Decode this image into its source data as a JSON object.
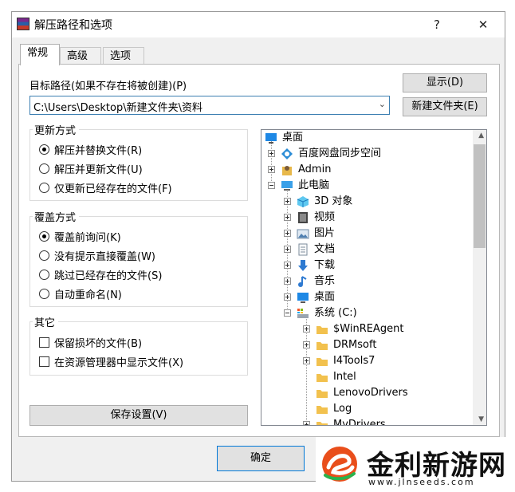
{
  "window": {
    "title": "解压路径和选项",
    "help_glyph": "?",
    "close_glyph": "✕"
  },
  "tabs": [
    "常规",
    "高级",
    "选项"
  ],
  "target": {
    "label": "目标路径(如果不存在将被创建)(P)",
    "value": "C:\\Users\\Desktop\\新建文件夹\\资料",
    "arrow": "⌄"
  },
  "buttons": {
    "show": "显示(D)",
    "new_folder": "新建文件夹(E)",
    "save": "保存设置(V)",
    "ok": "确定"
  },
  "update_mode": {
    "title": "更新方式",
    "options": [
      "解压并替换文件(R)",
      "解压并更新文件(U)",
      "仅更新已经存在的文件(F)"
    ],
    "selected": 0
  },
  "overwrite_mode": {
    "title": "覆盖方式",
    "options": [
      "覆盖前询问(K)",
      "没有提示直接覆盖(W)",
      "跳过已经存在的文件(S)",
      "自动重命名(N)"
    ],
    "selected": 0
  },
  "misc": {
    "title": "其它",
    "options": [
      "保留损坏的文件(B)",
      "在资源管理器中显示文件(X)"
    ]
  },
  "tree": [
    {
      "label": "桌面",
      "icon": "desktop-icon"
    },
    {
      "label": "百度网盘同步空间",
      "icon": "baidu-cloud-icon"
    },
    {
      "label": "Admin",
      "icon": "user-icon"
    },
    {
      "label": "此电脑",
      "icon": "computer-icon"
    },
    {
      "label": "3D 对象",
      "icon": "3d-objects-icon"
    },
    {
      "label": "视频",
      "icon": "video-icon"
    },
    {
      "label": "图片",
      "icon": "pictures-icon"
    },
    {
      "label": "文档",
      "icon": "documents-icon"
    },
    {
      "label": "下载",
      "icon": "download-icon"
    },
    {
      "label": "音乐",
      "icon": "music-icon"
    },
    {
      "label": "桌面",
      "icon": "desktop-icon"
    },
    {
      "label": "系统 (C:)",
      "icon": "drive-icon"
    },
    {
      "label": "$WinREAgent",
      "icon": "folder-icon"
    },
    {
      "label": "DRMsoft",
      "icon": "folder-icon"
    },
    {
      "label": "I4Tools7",
      "icon": "folder-icon"
    },
    {
      "label": "Intel",
      "icon": "folder-icon"
    },
    {
      "label": "LenovoDrivers",
      "icon": "folder-icon"
    },
    {
      "label": "Log",
      "icon": "folder-icon"
    },
    {
      "label": "MyDrivers",
      "icon": "folder-icon"
    }
  ],
  "watermark": {
    "brand": "金利新游网",
    "url": "www.jlnseeds.com"
  },
  "colors": {
    "accent": "#3c7fb1",
    "folder": "#f2c14e"
  }
}
